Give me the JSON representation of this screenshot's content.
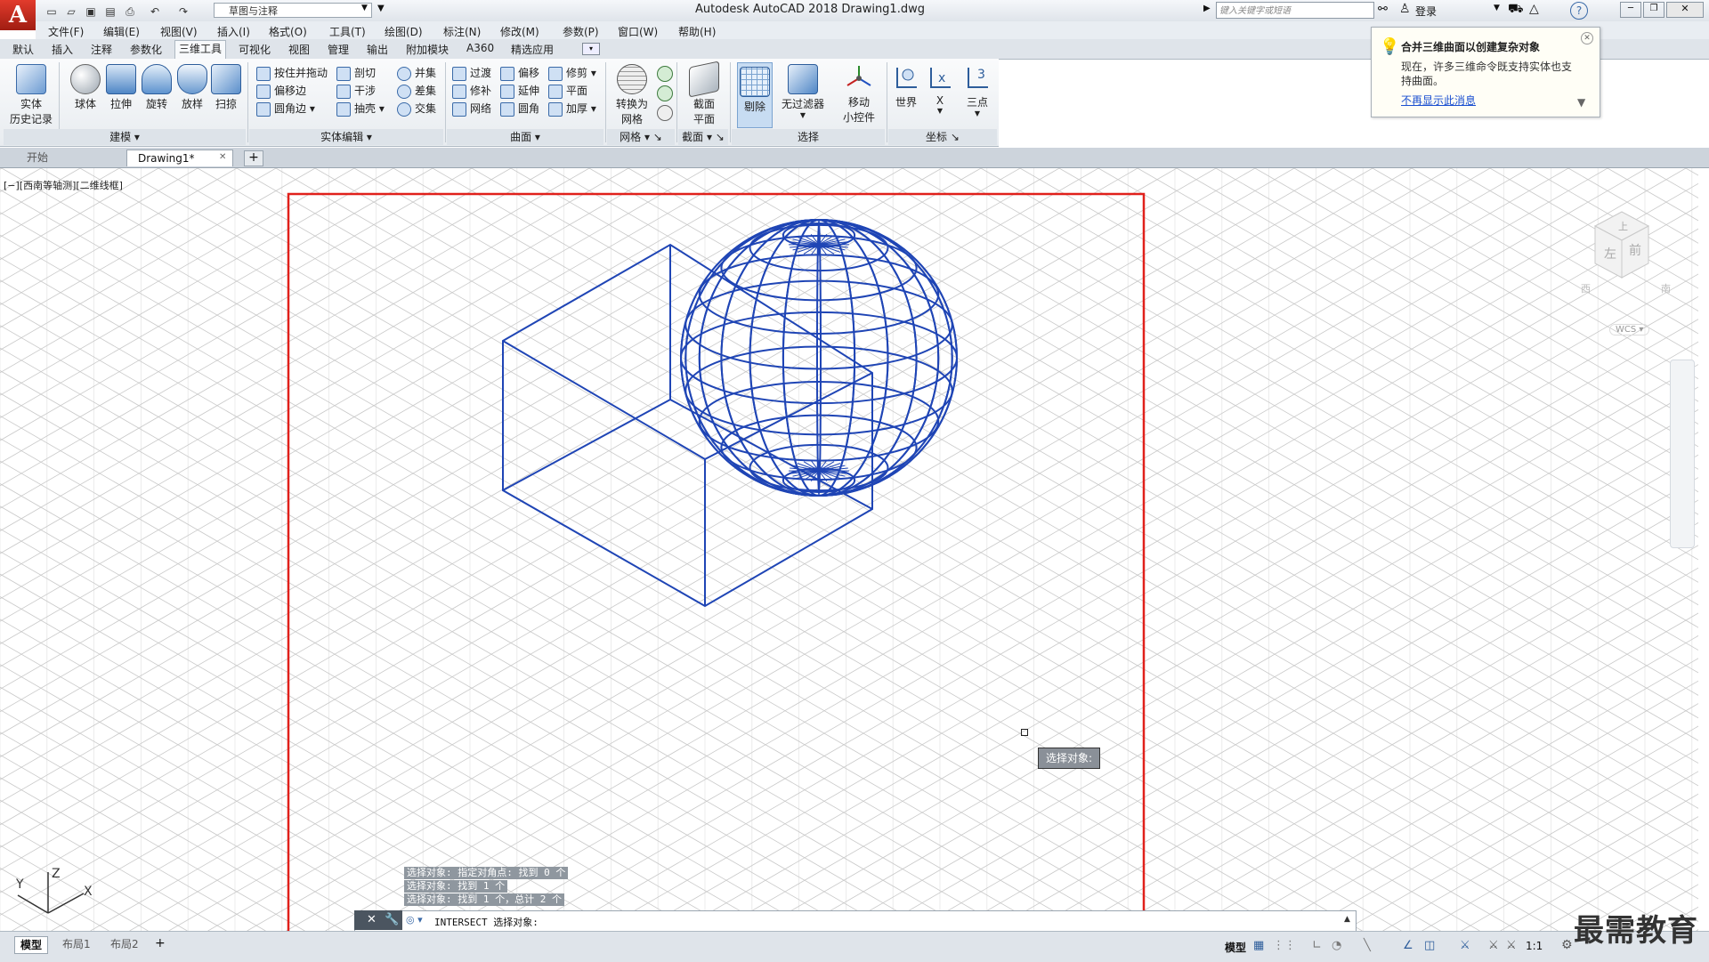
{
  "app": {
    "logo_letter": "A",
    "window_title": "Autodesk AutoCAD 2018    Drawing1.dwg",
    "workspace": "草图与注释",
    "search_placeholder": "键入关键字或短语",
    "login": "登录"
  },
  "menu": [
    "文件(F)",
    "编辑(E)",
    "视图(V)",
    "插入(I)",
    "格式(O)",
    "工具(T)",
    "绘图(D)",
    "标注(N)",
    "修改(M)",
    "参数(P)",
    "窗口(W)",
    "帮助(H)"
  ],
  "ribbon_tabs": [
    "默认",
    "插入",
    "注释",
    "参数化",
    "三维工具",
    "可视化",
    "视图",
    "管理",
    "输出",
    "附加模块",
    "A360",
    "精选应用"
  ],
  "ribbon": {
    "history": [
      "实体",
      "历史记录"
    ],
    "modeling_buttons": [
      "球体",
      "拉伸",
      "旋转",
      "放样",
      "扫掠"
    ],
    "modeling_title": "建模",
    "solid_edit_col1": [
      "按住并拖动",
      "偏移边",
      "圆角边"
    ],
    "solid_edit_col2": [
      "剖切",
      "干涉",
      "抽壳"
    ],
    "solid_edit_col3": [
      "并集",
      "差集",
      "交集"
    ],
    "solid_edit_title": "实体编辑",
    "surface_col1": [
      "过渡",
      "修补",
      "网络"
    ],
    "surface_col2": [
      "偏移",
      "延伸",
      "圆角"
    ],
    "surface_col3": [
      "修剪",
      "平面",
      "加厚"
    ],
    "surface_title": "曲面",
    "mesh_btn": [
      "转换为",
      "网格"
    ],
    "mesh_title": "网格",
    "section_btn": [
      "截面",
      "平面"
    ],
    "section_title": "截面",
    "select_btns": [
      "剔除",
      "无过滤器"
    ],
    "gizmo_btn": [
      "移动",
      "小控件"
    ],
    "select_title": "选择",
    "coord_btns": [
      "世界",
      "X",
      "三点"
    ],
    "coord_title": "坐标"
  },
  "balloon": {
    "title": "合并三维曲面以创建复杂对象",
    "body": [
      "现在，许多三维命令既支持实体也支",
      "持曲面。"
    ],
    "link": "不再显示此消息"
  },
  "doc_tabs": [
    "开始",
    "Drawing1*"
  ],
  "viewport_label": "[−][西南等轴测][二维线框]",
  "viewcube": {
    "top": "上",
    "left": "左",
    "front": "前",
    "west": "西",
    "south": "南",
    "wcs": "WCS"
  },
  "ucs": {
    "x": "X",
    "y": "Y",
    "z": "Z"
  },
  "tooltip": "选择对象:",
  "command_history": [
    "选择对象: 指定对角点: 找到 0 个",
    "选择对象: 找到 1 个",
    "选择对象: 找到 1 个，总计 2 个"
  ],
  "command_line": "INTERSECT 选择对象:",
  "layout_tabs": [
    "模型",
    "布局1",
    "布局2"
  ],
  "status": {
    "model": "模型",
    "scale": "1:1"
  },
  "watermark": "最需教育",
  "colors": {
    "wire": "#1f45b5",
    "highlight_frame": "#e0201b",
    "grid": "#c9c9c9"
  }
}
